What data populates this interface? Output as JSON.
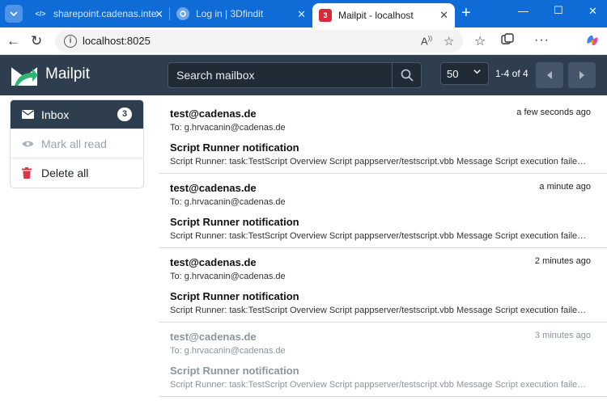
{
  "browser": {
    "tabs": [
      {
        "label": "sharepoint.cadenas.intern",
        "active": false
      },
      {
        "label": "Log in | 3Dfindit",
        "active": false
      },
      {
        "label": "Mailpit - localhost",
        "active": true,
        "favicon_badge": "3"
      }
    ],
    "url": "localhost:8025"
  },
  "app": {
    "brand": "Mailpit",
    "search_placeholder": "Search mailbox",
    "per_page": "50",
    "paging": "1-4 of 4"
  },
  "sidebar": {
    "items": [
      {
        "label": "Inbox",
        "badge": "3"
      },
      {
        "label": "Mark all read"
      },
      {
        "label": "Delete all"
      }
    ]
  },
  "messages": [
    {
      "from": "test@cadenas.de",
      "to": "To: g.hrvacanin@cadenas.de",
      "time": "a few seconds ago",
      "subject": "Script Runner notification",
      "snippet": "Script Runner: task:TestScript Overview Script pappserver/testscript.vbb Message Script execution failed Status",
      "read": false
    },
    {
      "from": "test@cadenas.de",
      "to": "To: g.hrvacanin@cadenas.de",
      "time": "a minute ago",
      "subject": "Script Runner notification",
      "snippet": "Script Runner: task:TestScript Overview Script pappserver/testscript.vbb Message Script execution failed Status",
      "read": false
    },
    {
      "from": "test@cadenas.de",
      "to": "To: g.hrvacanin@cadenas.de",
      "time": "2 minutes ago",
      "subject": "Script Runner notification",
      "snippet": "Script Runner: task:TestScript Overview Script pappserver/testscript.vbb Message Script execution failed Status",
      "read": false
    },
    {
      "from": "test@cadenas.de",
      "to": "To: g.hrvacanin@cadenas.de",
      "time": "3 minutes ago",
      "subject": "Script Runner notification",
      "snippet": "Script Runner: task:TestScript Overview Script pappserver/testscript.vbb Message Script execution failed Status",
      "read": true
    }
  ],
  "colors": {
    "header_bg": "#2e3e4e",
    "tab_strip_bg": "#0f6bd6",
    "logo_green": "#2fb673",
    "delete_red": "#dc3545"
  }
}
